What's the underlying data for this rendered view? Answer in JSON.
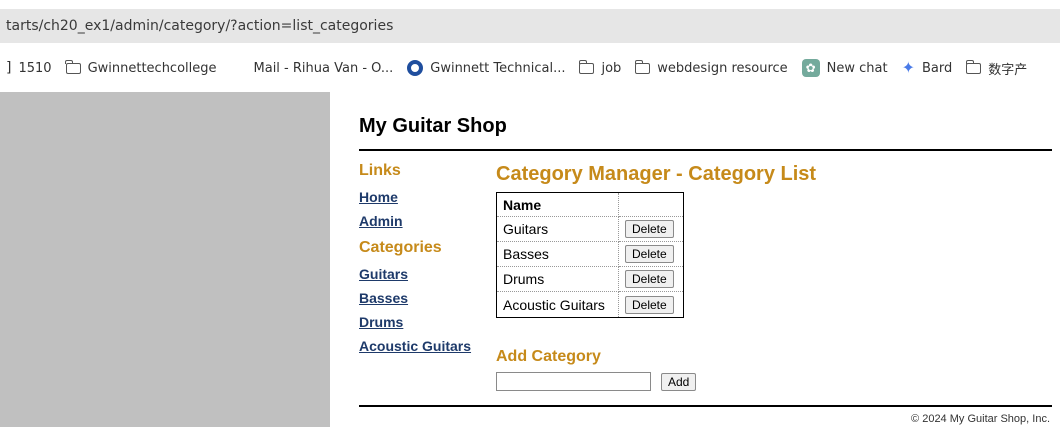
{
  "browser": {
    "url": "tarts/ch20_ex1/admin/category/?action=list_categories",
    "bookmarks": [
      {
        "icon": "folder-icon",
        "label": "1510"
      },
      {
        "icon": "folder-icon",
        "label": "Gwinnettechcollege"
      },
      {
        "icon": "microsoft-icon",
        "label": "Mail - Rihua Van - O..."
      },
      {
        "icon": "ring-icon",
        "label": "Gwinnett Technical..."
      },
      {
        "icon": "folder-icon",
        "label": "job"
      },
      {
        "icon": "folder-icon",
        "label": "webdesign resource"
      },
      {
        "icon": "chatgpt-icon",
        "label": "New chat"
      },
      {
        "icon": "sparkle-icon",
        "label": "Bard"
      },
      {
        "icon": "folder-icon",
        "label": "数字产"
      }
    ]
  },
  "header": {
    "title": "My Guitar Shop"
  },
  "sidebar": {
    "links_heading": "Links",
    "links": [
      "Home",
      "Admin"
    ],
    "categories_heading": "Categories",
    "categories": [
      "Guitars",
      "Basses",
      "Drums",
      "Acoustic Guitars"
    ]
  },
  "main": {
    "title": "Category Manager - Category List",
    "table": {
      "header": "Name",
      "rows": [
        {
          "name": "Guitars",
          "action": "Delete"
        },
        {
          "name": "Basses",
          "action": "Delete"
        },
        {
          "name": "Drums",
          "action": "Delete"
        },
        {
          "name": "Acoustic Guitars",
          "action": "Delete"
        }
      ]
    },
    "add_heading": "Add Category",
    "add_input_value": "",
    "add_button": "Add"
  },
  "footer": {
    "text": "© 2024 My Guitar Shop, Inc."
  },
  "colors": {
    "heading_accent": "#c68a1a",
    "link": "#1e3a6a",
    "left_background": "#c0c0c0"
  }
}
